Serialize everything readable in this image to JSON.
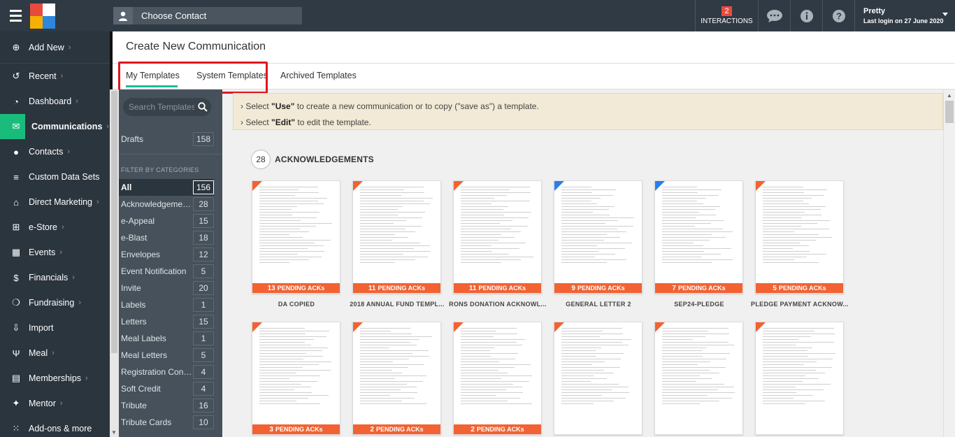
{
  "topbar": {
    "contact_label": "Choose Contact",
    "interactions_count": "2",
    "interactions_label": "INTERACTIONS",
    "user_name": "Pretty",
    "last_login": "Last login on 27 June 2020"
  },
  "sidebar": {
    "items": [
      {
        "label": "Add New",
        "icon": "plus-circle-icon"
      },
      {
        "label": "Recent",
        "icon": "history-icon"
      },
      {
        "label": "Dashboard",
        "icon": "dashboard-icon"
      },
      {
        "label": "Communications",
        "icon": "envelope-icon"
      },
      {
        "label": "Contacts",
        "icon": "user-icon"
      },
      {
        "label": "Custom Data Sets",
        "icon": "database-icon"
      },
      {
        "label": "Direct Marketing",
        "icon": "building-icon"
      },
      {
        "label": "e-Store",
        "icon": "cart-icon"
      },
      {
        "label": "Events",
        "icon": "calendar-icon"
      },
      {
        "label": "Financials",
        "icon": "money-icon"
      },
      {
        "label": "Fundraising",
        "icon": "money-bag-icon"
      },
      {
        "label": "Import",
        "icon": "import-icon"
      },
      {
        "label": "Meal",
        "icon": "cutlery-icon"
      },
      {
        "label": "Memberships",
        "icon": "id-card-icon"
      },
      {
        "label": "Mentor",
        "icon": "mentor-icon"
      },
      {
        "label": "Add-ons & more",
        "icon": "grid-icon"
      }
    ]
  },
  "page": {
    "title": "Create New Communication",
    "tabs": [
      "My Templates",
      "System Templates",
      "Archived Templates"
    ]
  },
  "categories": {
    "search_placeholder": "Search Templates",
    "drafts_label": "Drafts",
    "drafts_count": "158",
    "filter_label": "FILTER BY CATEGORIES",
    "items": [
      {
        "name": "All",
        "count": "156"
      },
      {
        "name": "Acknowledgements",
        "count": "28"
      },
      {
        "name": "e-Appeal",
        "count": "15"
      },
      {
        "name": "e-Blast",
        "count": "18"
      },
      {
        "name": "Envelopes",
        "count": "12"
      },
      {
        "name": "Event Notification",
        "count": "5"
      },
      {
        "name": "Invite",
        "count": "20"
      },
      {
        "name": "Labels",
        "count": "1"
      },
      {
        "name": "Letters",
        "count": "15"
      },
      {
        "name": "Meal Labels",
        "count": "1"
      },
      {
        "name": "Meal Letters",
        "count": "5"
      },
      {
        "name": "Registration Confirmation",
        "count": "4"
      },
      {
        "name": "Soft Credit",
        "count": "4"
      },
      {
        "name": "Tribute",
        "count": "16"
      },
      {
        "name": "Tribute Cards",
        "count": "10"
      }
    ]
  },
  "info": {
    "line1_pre": "Select ",
    "line1_bold": "\"Use\"",
    "line1_post": " to create a new communication or to copy (\"save as\") a template.",
    "line2_pre": "Select ",
    "line2_bold": "\"Edit\"",
    "line2_post": " to edit the template."
  },
  "section": {
    "count": "28",
    "title": "ACKNOWLEDGEMENTS"
  },
  "pending_suffix": "PENDING ACKs",
  "cards": [
    {
      "name": "DA COPIED",
      "pending": "13",
      "corner": "#f26232"
    },
    {
      "name": "2018 ANNUAL FUND TEMPL...",
      "pending": "11",
      "corner": "#f26232"
    },
    {
      "name": "RONS DONATION ACKNOWL...",
      "pending": "11",
      "corner": "#f26232"
    },
    {
      "name": "GENERAL LETTER 2",
      "pending": "9",
      "corner": "#2b7de9"
    },
    {
      "name": "SEP24-PLEDGE",
      "pending": "7",
      "corner": "#2b7de9"
    },
    {
      "name": "PLEDGE PAYMENT ACKNOW...",
      "pending": "5",
      "corner": "#f26232"
    },
    {
      "name": "",
      "pending": "3",
      "corner": "#f26232"
    },
    {
      "name": "",
      "pending": "2",
      "corner": "#f26232"
    },
    {
      "name": "",
      "pending": "2",
      "corner": "#f26232"
    },
    {
      "name": "",
      "pending": "",
      "corner": "#f26232"
    },
    {
      "name": "",
      "pending": "",
      "corner": "#f26232"
    },
    {
      "name": "",
      "pending": "",
      "corner": "#f26232"
    }
  ],
  "colors": {
    "accent_green": "#1abc9c",
    "pending_orange": "#f26232",
    "highlight_red": "#e0161e"
  }
}
